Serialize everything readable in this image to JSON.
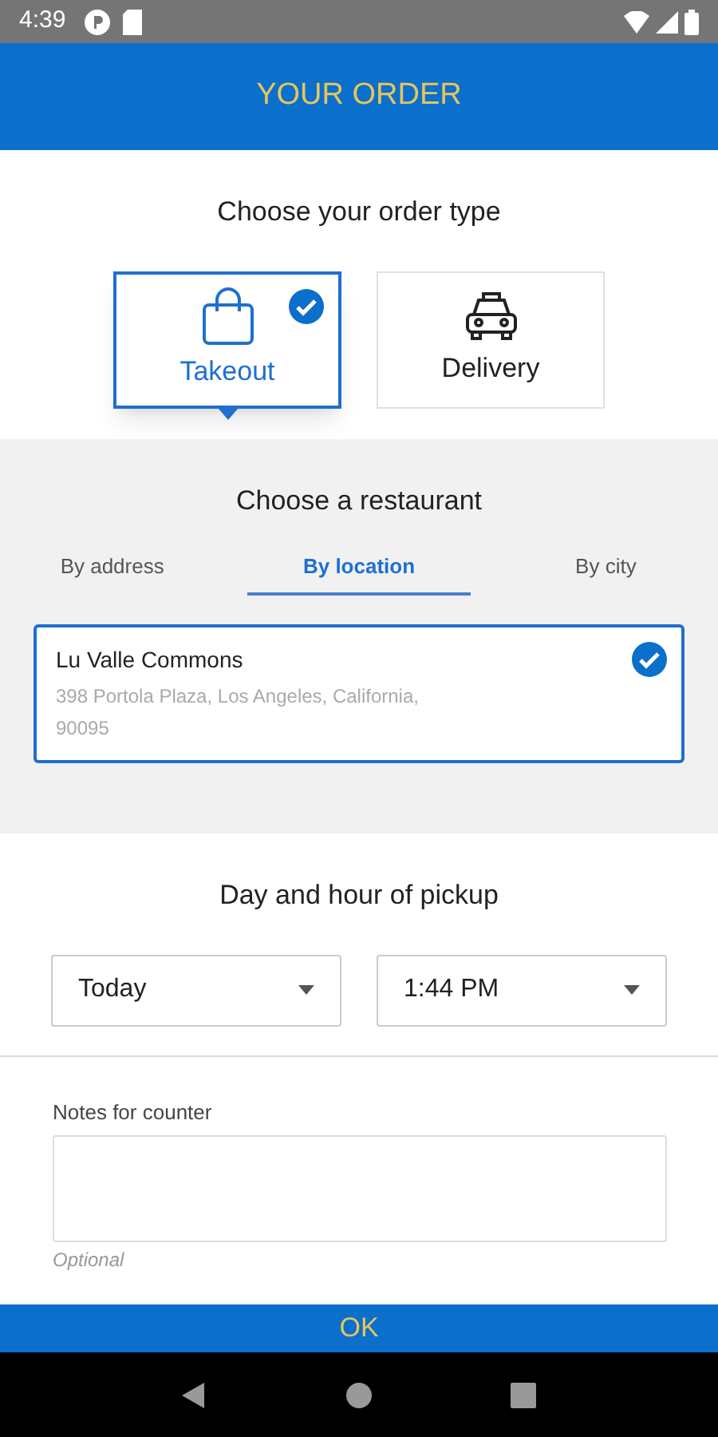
{
  "status_bar": {
    "time": "4:39"
  },
  "header": {
    "title": "YOUR ORDER"
  },
  "order_type": {
    "heading": "Choose your order type",
    "options": [
      {
        "kind": "takeout",
        "label": "Takeout",
        "selected": true
      },
      {
        "kind": "delivery",
        "label": "Delivery",
        "selected": false
      }
    ]
  },
  "restaurant": {
    "heading": "Choose a restaurant",
    "tabs": [
      {
        "label": "By address",
        "selected": false
      },
      {
        "label": "By location",
        "selected": true
      },
      {
        "label": "By city",
        "selected": false
      }
    ],
    "results": [
      {
        "name": "Lu Valle Commons",
        "address": "398 Portola Plaza, Los Angeles, California, 90095",
        "selected": true
      }
    ]
  },
  "pickup": {
    "heading": "Day and hour of pickup",
    "day": "Today",
    "time": "1:44 PM"
  },
  "notes": {
    "label": "Notes for counter",
    "helper": "Optional"
  },
  "ok_button": {
    "label": "OK"
  }
}
